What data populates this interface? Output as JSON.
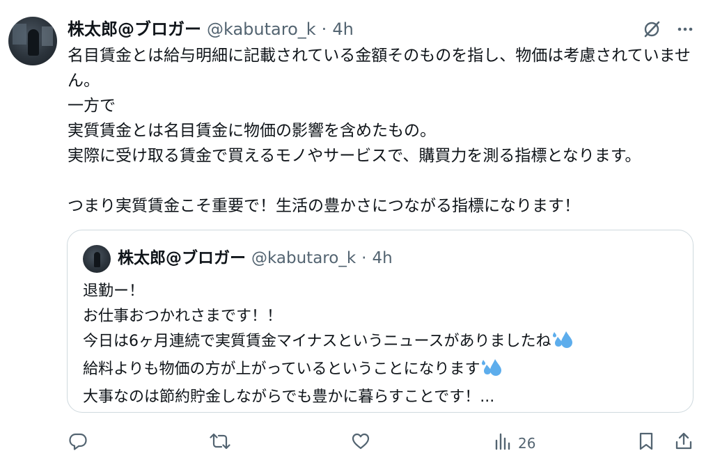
{
  "tweet": {
    "author_name": "株太郎@ブロガー",
    "handle": "@kabutaro_k",
    "separator": "·",
    "time": "4h",
    "text": "名目賃金とは給与明細に記載されている金額そのものを指し、物価は考慮されていません。\n一方で\n実質賃金とは名目賃金に物価の影響を含めたもの。\n実際に受け取る賃金で買えるモノやサービスで、購買力を測る指標となります。\n\nつまり実質賃金こそ重要で！生活の豊かさにつながる指標になります！"
  },
  "quote": {
    "author_name": "株太郎@ブロガー",
    "handle": "@kabutaro_k",
    "separator": "·",
    "time": "4h",
    "lines": [
      "退勤ー！",
      "お仕事おつかれさまです！！",
      "今日は6ヶ月連続で実質賃金マイナスというニュースがありましたね",
      "給料よりも物価の方が上がっているということになります",
      "大事なのは節約貯金しながらでも豊かに暮らすことです！..."
    ]
  },
  "actions": {
    "views_count": "26"
  },
  "icons": {
    "grok": "grok-icon",
    "more": "more-options-icon",
    "reply": "reply-icon",
    "retweet": "retweet-icon",
    "like": "like-icon",
    "views": "views-icon",
    "bookmark": "bookmark-icon",
    "share": "share-icon",
    "sweat": "sweat-droplets-emoji"
  },
  "colors": {
    "text": "#0f1419",
    "secondary": "#536471",
    "border": "#cfd9de",
    "emoji_blue": "#5dadec"
  }
}
